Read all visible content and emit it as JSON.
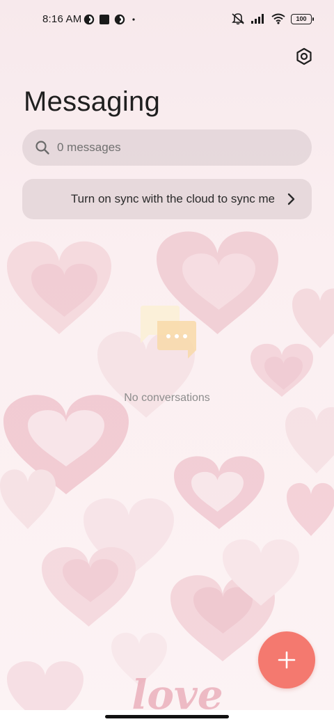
{
  "status_bar": {
    "time": "8:16 AM",
    "left_icons": [
      "app-notification-icon",
      "stop-icon",
      "app-notification-icon",
      "dot-icon"
    ],
    "right_icons": [
      "mute-icon",
      "signal-icon",
      "wifi-icon"
    ],
    "battery_level": "100"
  },
  "header": {
    "title": "Messaging",
    "settings_icon": "settings-icon"
  },
  "search": {
    "placeholder": "0 messages"
  },
  "sync_banner": {
    "text": "Turn on sync with the cloud to sync messages"
  },
  "empty_state": {
    "text": "No conversations"
  },
  "fab": {
    "icon": "plus-icon"
  },
  "wallpaper": {
    "text": "love"
  },
  "colors": {
    "accent": "#f4796f",
    "background": "#f8ecef"
  }
}
